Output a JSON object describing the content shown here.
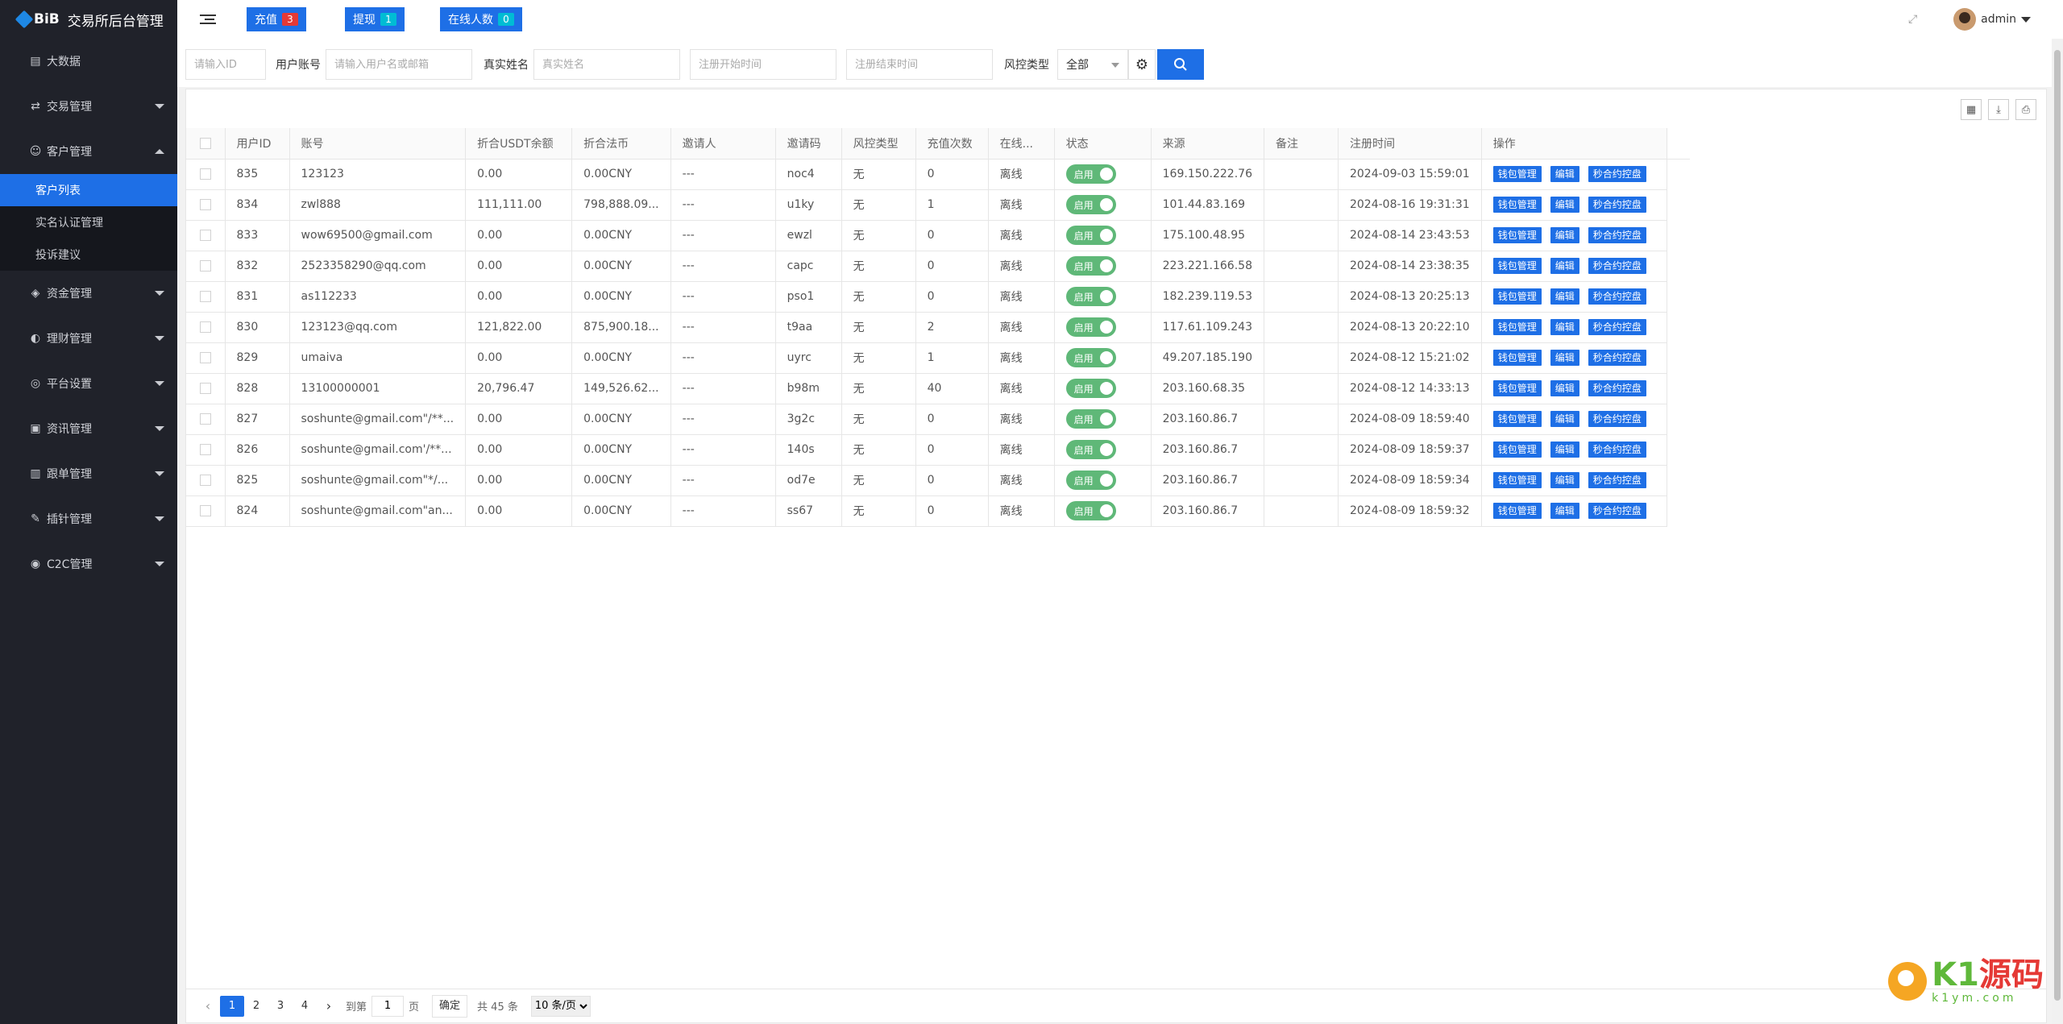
{
  "sidebar": {
    "logo_mark": "BiB",
    "logo_title": "交易所后台管理",
    "items": [
      {
        "label": "大数据",
        "icon": "chart-icon",
        "has_caret": false
      },
      {
        "label": "交易管理",
        "icon": "exchange-icon",
        "has_caret": true
      },
      {
        "label": "客户管理",
        "icon": "user-icon",
        "has_caret": true,
        "open": true
      },
      {
        "label": "资金管理",
        "icon": "wallet-icon",
        "has_caret": true
      },
      {
        "label": "理财管理",
        "icon": "piggy-icon",
        "has_caret": true
      },
      {
        "label": "平台设置",
        "icon": "settings-icon",
        "has_caret": true
      },
      {
        "label": "资讯管理",
        "icon": "news-icon",
        "has_caret": true
      },
      {
        "label": "跟单管理",
        "icon": "follow-icon",
        "has_caret": true
      },
      {
        "label": "插针管理",
        "icon": "pin-icon",
        "has_caret": true
      },
      {
        "label": "C2C管理",
        "icon": "c2c-icon",
        "has_caret": true
      }
    ],
    "sub_items": [
      {
        "label": "客户列表",
        "active": true
      },
      {
        "label": "实名认证管理",
        "active": false
      },
      {
        "label": "投诉建议",
        "active": false
      }
    ]
  },
  "header": {
    "recharge_label": "充值",
    "recharge_count": "3",
    "withdraw_label": "提现",
    "withdraw_count": "1",
    "online_label": "在线人数",
    "online_count": "0",
    "user_name": "admin",
    "colors": {
      "primary": "#1e6fe6",
      "badge_red": "#e53935",
      "badge_cyan": "#00bcd4",
      "toggle_green": "#5fb878"
    }
  },
  "filters": {
    "id_placeholder": "请输入ID",
    "account_label": "用户账号",
    "account_placeholder": "请输入用户名或邮箱",
    "realname_label": "真实姓名",
    "realname_placeholder": "真实姓名",
    "reg_start_placeholder": "注册开始时间",
    "reg_end_placeholder": "注册结束时间",
    "risk_label": "风控类型",
    "risk_value": "全部"
  },
  "table": {
    "columns": [
      "用户ID",
      "账号",
      "折合USDT余额",
      "折合法币",
      "邀请人",
      "邀请码",
      "风控类型",
      "充值次数",
      "在线...",
      "状态",
      "来源",
      "备注",
      "注册时间",
      "操作"
    ],
    "status_label": "启用",
    "action_labels": [
      "钱包管理",
      "编辑",
      "秒合约控盘"
    ],
    "rows": [
      {
        "id": "835",
        "account": "123123",
        "usdt": "0.00",
        "fiat": "0.00CNY",
        "inviter": "---",
        "code": "noc4",
        "risk": "无",
        "recharge": "0",
        "online": "离线",
        "source": "169.150.222.76",
        "note": "",
        "time": "2024-09-03 15:59:01"
      },
      {
        "id": "834",
        "account": "zwl888",
        "usdt": "111,111.00",
        "fiat": "798,888.09...",
        "inviter": "---",
        "code": "u1ky",
        "risk": "无",
        "recharge": "1",
        "online": "离线",
        "source": "101.44.83.169",
        "note": "",
        "time": "2024-08-16 19:31:31"
      },
      {
        "id": "833",
        "account": "wow69500@gmail.com",
        "usdt": "0.00",
        "fiat": "0.00CNY",
        "inviter": "---",
        "code": "ewzl",
        "risk": "无",
        "recharge": "0",
        "online": "离线",
        "source": "175.100.48.95",
        "note": "",
        "time": "2024-08-14 23:43:53"
      },
      {
        "id": "832",
        "account": "2523358290@qq.com",
        "usdt": "0.00",
        "fiat": "0.00CNY",
        "inviter": "---",
        "code": "capc",
        "risk": "无",
        "recharge": "0",
        "online": "离线",
        "source": "223.221.166.58",
        "note": "",
        "time": "2024-08-14 23:38:35"
      },
      {
        "id": "831",
        "account": "as112233",
        "usdt": "0.00",
        "fiat": "0.00CNY",
        "inviter": "---",
        "code": "pso1",
        "risk": "无",
        "recharge": "0",
        "online": "离线",
        "source": "182.239.119.53",
        "note": "",
        "time": "2024-08-13 20:25:13"
      },
      {
        "id": "830",
        "account": "123123@qq.com",
        "usdt": "121,822.00",
        "fiat": "875,900.18...",
        "inviter": "---",
        "code": "t9aa",
        "risk": "无",
        "recharge": "2",
        "online": "离线",
        "source": "117.61.109.243",
        "note": "",
        "time": "2024-08-13 20:22:10"
      },
      {
        "id": "829",
        "account": "umaiva",
        "usdt": "0.00",
        "fiat": "0.00CNY",
        "inviter": "---",
        "code": "uyrc",
        "risk": "无",
        "recharge": "1",
        "online": "离线",
        "source": "49.207.185.190",
        "note": "",
        "time": "2024-08-12 15:21:02"
      },
      {
        "id": "828",
        "account": "13100000001",
        "usdt": "20,796.47",
        "fiat": "149,526.62...",
        "inviter": "---",
        "code": "b98m",
        "risk": "无",
        "recharge": "40",
        "online": "离线",
        "source": "203.160.68.35",
        "note": "",
        "time": "2024-08-12 14:33:13"
      },
      {
        "id": "827",
        "account": "soshunte@gmail.com\"/**...",
        "usdt": "0.00",
        "fiat": "0.00CNY",
        "inviter": "---",
        "code": "3g2c",
        "risk": "无",
        "recharge": "0",
        "online": "离线",
        "source": "203.160.86.7",
        "note": "",
        "time": "2024-08-09 18:59:40"
      },
      {
        "id": "826",
        "account": "soshunte@gmail.com'/**...",
        "usdt": "0.00",
        "fiat": "0.00CNY",
        "inviter": "---",
        "code": "140s",
        "risk": "无",
        "recharge": "0",
        "online": "离线",
        "source": "203.160.86.7",
        "note": "",
        "time": "2024-08-09 18:59:37"
      },
      {
        "id": "825",
        "account": "soshunte@gmail.com\"*/...",
        "usdt": "0.00",
        "fiat": "0.00CNY",
        "inviter": "---",
        "code": "od7e",
        "risk": "无",
        "recharge": "0",
        "online": "离线",
        "source": "203.160.86.7",
        "note": "",
        "time": "2024-08-09 18:59:34"
      },
      {
        "id": "824",
        "account": "soshunte@gmail.com\"an...",
        "usdt": "0.00",
        "fiat": "0.00CNY",
        "inviter": "---",
        "code": "ss67",
        "risk": "无",
        "recharge": "0",
        "online": "离线",
        "source": "203.160.86.7",
        "note": "",
        "time": "2024-08-09 18:59:32"
      }
    ]
  },
  "pager": {
    "pages": [
      "1",
      "2",
      "3",
      "4"
    ],
    "active_page": "1",
    "goto_label": "到第",
    "goto_value": "1",
    "page_unit": "页",
    "confirm_label": "确定",
    "total_text": "共 45 条",
    "page_size": "10 条/页"
  },
  "watermark": {
    "big_k": "K1",
    "big_red": "源码",
    "small": "k1ym.com"
  }
}
